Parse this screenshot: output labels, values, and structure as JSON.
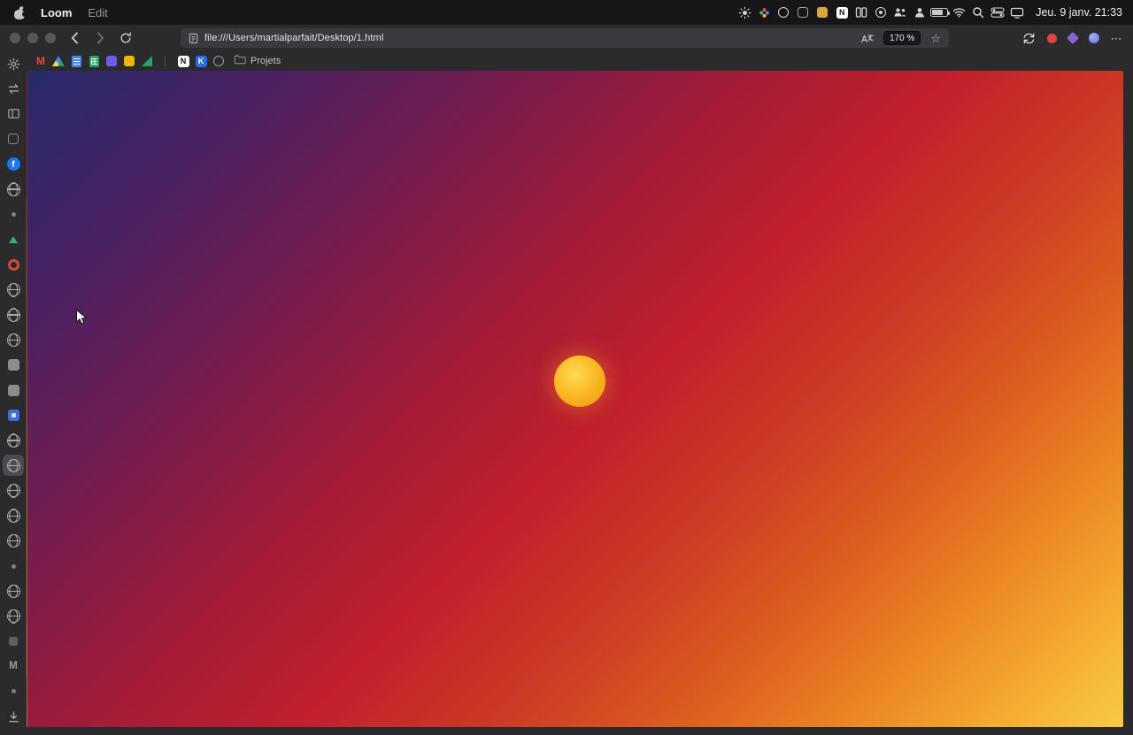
{
  "menubar": {
    "app_name": "Loom",
    "menus": [
      {
        "label": "Edit"
      }
    ],
    "clock": "Jeu. 9 janv. 21:33",
    "status_icons": [
      {
        "name": "brightness-icon",
        "type": "sun"
      },
      {
        "name": "colors-icon",
        "type": "flower"
      },
      {
        "name": "assistant-icon",
        "type": "ring-gray"
      },
      {
        "name": "capture-icon",
        "type": "sq-outline"
      },
      {
        "name": "launcher-icon",
        "type": "sq-amber"
      },
      {
        "name": "notion-icon",
        "type": "notion",
        "glyph": "N"
      },
      {
        "name": "window-manager-icon",
        "type": "columns"
      },
      {
        "name": "input-source-icon",
        "type": "ring-dot"
      },
      {
        "name": "team-icon",
        "type": "people"
      },
      {
        "name": "user-icon",
        "type": "person"
      },
      {
        "name": "battery-icon",
        "type": "battery"
      },
      {
        "name": "wifi-icon",
        "type": "wifi"
      },
      {
        "name": "spotlight-icon",
        "type": "search"
      },
      {
        "name": "control-center-icon",
        "type": "toggles"
      },
      {
        "name": "display-icon",
        "type": "display"
      }
    ]
  },
  "toolbar": {
    "nav_icons": [
      {
        "name": "back-button",
        "type": "chevron-left"
      },
      {
        "name": "forward-button",
        "type": "chevron-right",
        "dim": true
      },
      {
        "name": "reload-button",
        "type": "reload"
      }
    ],
    "url": "file:///Users/martialparfait/Desktop/1.html",
    "zoom_label": "170 %",
    "star_glyph": "☆",
    "right_icons": [
      {
        "name": "sync-icon",
        "type": "sync"
      },
      {
        "name": "extension-red-icon",
        "type": "dot-red"
      },
      {
        "name": "extension-purple-icon",
        "type": "diamond-purple"
      },
      {
        "name": "account-icon",
        "type": "dot-blue"
      },
      {
        "name": "more-button",
        "type": "more",
        "glyph": "⋯"
      }
    ]
  },
  "bookmarks": {
    "favicons": [
      {
        "name": "gmail-favicon",
        "type": "gmail",
        "glyph": "M"
      },
      {
        "name": "drive-favicon",
        "type": "drive"
      },
      {
        "name": "docs-favicon",
        "type": "docs"
      },
      {
        "name": "sheets-favicon",
        "type": "sheets"
      },
      {
        "name": "calendar-favicon",
        "type": "app-purple"
      },
      {
        "name": "slides-favicon",
        "type": "app-yellow"
      },
      {
        "name": "analytics-favicon",
        "type": "tri-chart"
      }
    ],
    "favicons2": [
      {
        "name": "notion-favicon",
        "type": "notion",
        "glyph": "N"
      },
      {
        "name": "keynote-favicon",
        "type": "kblue",
        "glyph": "K"
      },
      {
        "name": "web-favicon",
        "type": "ring-gray"
      }
    ],
    "folder_label": "Projets"
  },
  "sidebar": {
    "items": [
      {
        "name": "settings-icon",
        "type": "gear"
      },
      {
        "name": "swap-tabs-icon",
        "type": "arrows"
      },
      {
        "name": "sidebar-toggle-icon",
        "type": "panel"
      },
      {
        "name": "workspace-app-icon",
        "type": "sq-outline"
      },
      {
        "name": "facebook-tab-icon",
        "type": "facebook",
        "glyph": "f"
      },
      {
        "name": "web-tab-icon",
        "type": "globe"
      },
      {
        "name": "small-tab-icon",
        "type": "mini-dot"
      },
      {
        "name": "pinned-tab-icon",
        "type": "tri-green"
      },
      {
        "name": "logo-tab-icon",
        "type": "ring-red"
      },
      {
        "name": "web-tab-icon",
        "type": "globe"
      },
      {
        "name": "web-tab-icon",
        "type": "globe"
      },
      {
        "name": "web-tab-icon",
        "type": "globe"
      },
      {
        "name": "media-tab-icon",
        "type": "sq-gray"
      },
      {
        "name": "media-tab-icon",
        "type": "sq-gray"
      },
      {
        "name": "app-tab-icon",
        "type": "sq-blue"
      },
      {
        "name": "web-tab-icon",
        "type": "globe"
      },
      {
        "name": "active-web-tab-icon",
        "type": "globe",
        "active": true
      },
      {
        "name": "web-tab-icon",
        "type": "globe"
      },
      {
        "name": "web-tab-icon",
        "type": "globe"
      },
      {
        "name": "web-tab-icon",
        "type": "globe"
      },
      {
        "name": "small-tab-icon",
        "type": "mini-dot"
      },
      {
        "name": "web-tab-icon",
        "type": "globe"
      },
      {
        "name": "web-tab-icon",
        "type": "globe"
      },
      {
        "name": "small-tab-icon",
        "type": "sq-dim"
      },
      {
        "name": "m-tab-icon",
        "type": "mletter",
        "glyph": "M"
      },
      {
        "name": "small-tab-icon",
        "type": "mini-dot"
      },
      {
        "name": "downloads-icon",
        "type": "download"
      }
    ]
  },
  "page": {
    "background_gradient_stops": [
      "#272b6b 0%",
      "#4a2162 14%",
      "#7a1c4b 29%",
      "#a61c36 42%",
      "#c1202c 53%",
      "#cd3a25 64%",
      "#de5f1f 75%",
      "#ec8a24 85%",
      "#f4ae31 93%",
      "#f8ca43 100%"
    ],
    "sun": {
      "center": "#ffda52",
      "mid": "#f9b31f",
      "edge": "#f0960e"
    }
  }
}
